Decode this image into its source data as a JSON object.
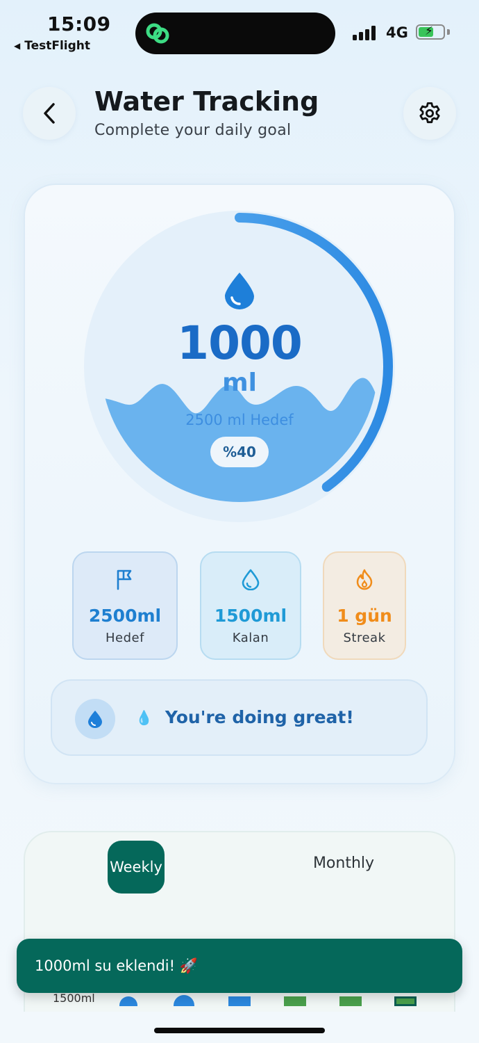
{
  "status_bar": {
    "time": "15:09",
    "back_app": "TestFlight",
    "network": "4G"
  },
  "header": {
    "title": "Water Tracking",
    "subtitle": "Complete your daily goal"
  },
  "gauge": {
    "amount": "1000",
    "unit": "ml",
    "goal_text": "2500 ml Hedef",
    "percent_label": "%40",
    "progress": 0.4
  },
  "stats": [
    {
      "value": "2500ml",
      "label": "Hedef",
      "icon": "flag-icon",
      "color": "#1e7fd0"
    },
    {
      "value": "1500ml",
      "label": "Kalan",
      "icon": "water-drop-outline-icon",
      "color": "#1f9ad6"
    },
    {
      "value": "1 gün",
      "label": "Streak",
      "icon": "fire-icon",
      "color": "#f08c1a"
    }
  ],
  "encouragement": {
    "text": "You're doing great!",
    "emoji": "💧"
  },
  "period_tabs": {
    "weekly": "Weekly",
    "monthly": "Monthly",
    "selected": "Weekly"
  },
  "chart_partial": {
    "axis_label": "1500ml"
  },
  "toast": {
    "message": "1000ml su eklendi! 🚀"
  },
  "colors": {
    "primary_blue": "#1a6bc6",
    "water_blue": "#6ab3ee",
    "ring_blue": "#3b95e6",
    "brand_green": "#05685a",
    "streak_orange": "#f08c1a"
  }
}
